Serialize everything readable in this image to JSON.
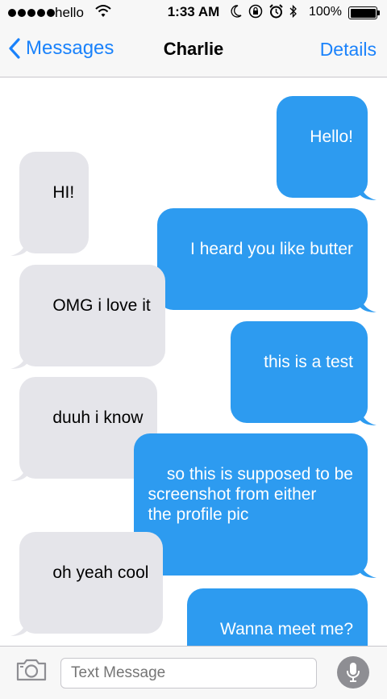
{
  "status_bar": {
    "carrier": "hello",
    "time": "1:33 AM",
    "battery_percent": "100%"
  },
  "nav": {
    "back_label": "Messages",
    "title": "Charlie",
    "details_label": "Details"
  },
  "messages": [
    {
      "direction": "out",
      "text": "Hello!"
    },
    {
      "direction": "in",
      "text": "HI!"
    },
    {
      "direction": "out",
      "text": "I heard you like butter"
    },
    {
      "direction": "in",
      "text": "OMG i love it"
    },
    {
      "direction": "out",
      "text": "this is a test"
    },
    {
      "direction": "in",
      "text": "duuh i know"
    },
    {
      "direction": "out",
      "text": "so this is supposed to be\nscreenshot from either\nthe profile pic"
    },
    {
      "direction": "in",
      "text": "oh yeah cool"
    },
    {
      "direction": "out",
      "text": "Wanna meet me?"
    }
  ],
  "composer": {
    "placeholder": "Text Message"
  },
  "colors": {
    "accent": "#1a82fb",
    "outgoing_bubble": "#2d9bf0",
    "incoming_bubble": "#e5e5ea"
  },
  "icons": [
    "signal-dots-icon",
    "wifi-icon",
    "moon-icon",
    "rotation-lock-icon",
    "alarm-icon",
    "bluetooth-icon",
    "battery-icon",
    "back-chevron-icon",
    "camera-icon",
    "microphone-icon"
  ]
}
